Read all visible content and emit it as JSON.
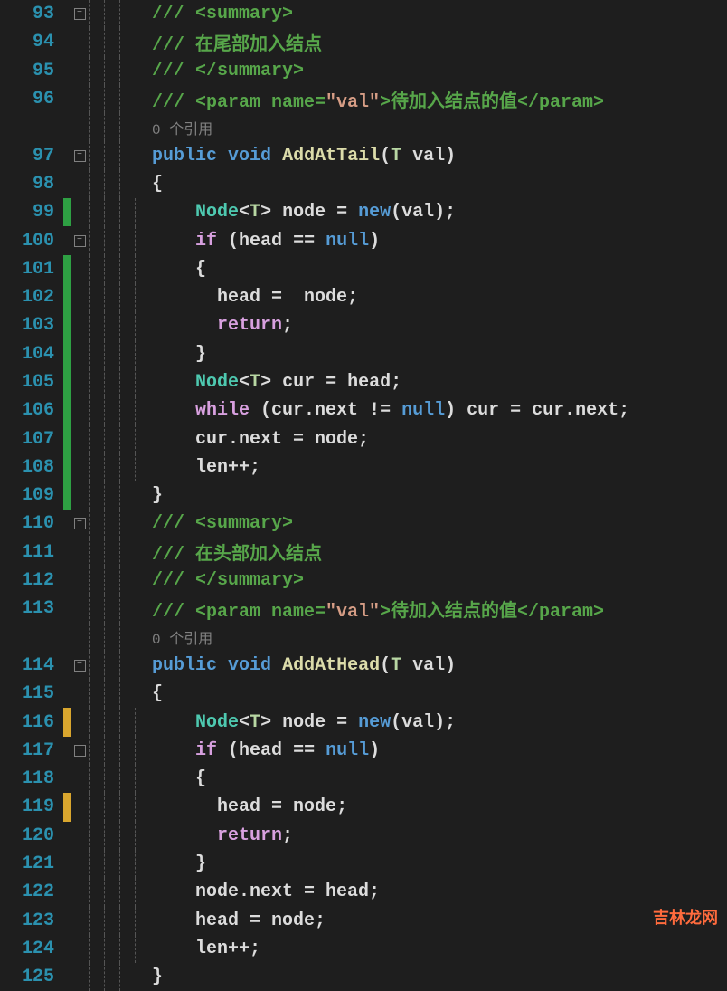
{
  "watermark": "吉林龙网",
  "lines": {
    "l93": {
      "num": "93",
      "comment": "/// <summary>"
    },
    "l94": {
      "num": "94",
      "comment": "/// 在尾部加入结点"
    },
    "l95": {
      "num": "95",
      "comment": "/// </summary>"
    },
    "l96": {
      "num": "96",
      "c1": "/// <param name=",
      "str": "\"val\"",
      "c2": ">待加入结点的值</param>"
    },
    "codelens1": "0 个引用",
    "l97": {
      "num": "97",
      "kw1": "public",
      "kw2": "void",
      "method": "AddAtTail",
      "typep": "T",
      "param": "val"
    },
    "l98": {
      "num": "98",
      "brace": "{"
    },
    "l99": {
      "num": "99",
      "type": "Node",
      "typep": "T",
      "var": "node",
      "kw": "new",
      "param": "val"
    },
    "l100": {
      "num": "100",
      "ctrl": "if",
      "cond1": "head",
      "op": "==",
      "kw": "null"
    },
    "l101": {
      "num": "101",
      "brace": "{"
    },
    "l102": {
      "num": "102",
      "lhs": "head",
      "rhs": "node"
    },
    "l103": {
      "num": "103",
      "ret": "return"
    },
    "l104": {
      "num": "104",
      "brace": "}"
    },
    "l105": {
      "num": "105",
      "type": "Node",
      "typep": "T",
      "var": "cur",
      "rhs": "head"
    },
    "l106": {
      "num": "106",
      "ctrl": "while",
      "cond": "cur.next",
      "op": "!=",
      "kw": "null",
      "stmt": "cur = cur.next;"
    },
    "l107": {
      "num": "107",
      "stmt": "cur.next = node;"
    },
    "l108": {
      "num": "108",
      "stmt": "len++;"
    },
    "l109": {
      "num": "109",
      "brace": "}"
    },
    "l110": {
      "num": "110",
      "comment": "/// <summary>"
    },
    "l111": {
      "num": "111",
      "comment": "/// 在头部加入结点"
    },
    "l112": {
      "num": "112",
      "comment": "/// </summary>"
    },
    "l113": {
      "num": "113",
      "c1": "/// <param name=",
      "str": "\"val\"",
      "c2": ">待加入结点的值</param>"
    },
    "codelens2": "0 个引用",
    "l114": {
      "num": "114",
      "kw1": "public",
      "kw2": "void",
      "method": "AddAtHead",
      "typep": "T",
      "param": "val"
    },
    "l115": {
      "num": "115",
      "brace": "{"
    },
    "l116": {
      "num": "116",
      "type": "Node",
      "typep": "T",
      "var": "node",
      "kw": "new",
      "param": "val"
    },
    "l117": {
      "num": "117",
      "ctrl": "if",
      "cond1": "head",
      "op": "==",
      "kw": "null"
    },
    "l118": {
      "num": "118",
      "brace": "{"
    },
    "l119": {
      "num": "119",
      "lhs": "head",
      "rhs": "node"
    },
    "l120": {
      "num": "120",
      "ret": "return"
    },
    "l121": {
      "num": "121",
      "brace": "}"
    },
    "l122": {
      "num": "122",
      "stmt": "node.next = head;"
    },
    "l123": {
      "num": "123",
      "stmt": "head = node;"
    },
    "l124": {
      "num": "124",
      "stmt": "len++;"
    },
    "l125": {
      "num": "125",
      "brace": "}"
    }
  }
}
